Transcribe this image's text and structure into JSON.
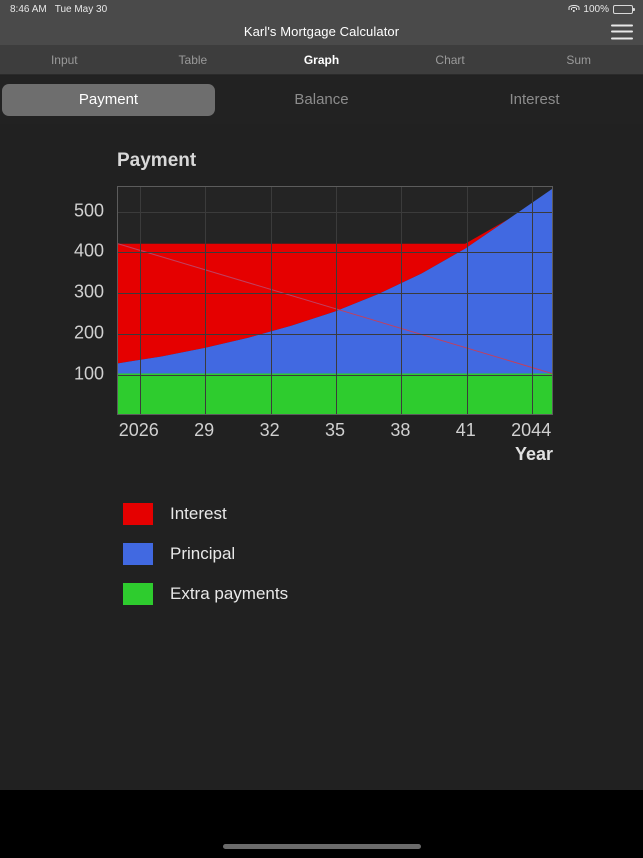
{
  "status_bar": {
    "time": "8:46 AM",
    "date": "Tue May 30",
    "battery_percent": "100%",
    "wifi_icon": "wifi-icon",
    "battery_icon": "battery-icon"
  },
  "nav": {
    "title": "Karl's Mortgage Calculator",
    "menu_icon": "hamburger-menu-icon"
  },
  "tabs": [
    {
      "label": "Input",
      "active": false
    },
    {
      "label": "Table",
      "active": false
    },
    {
      "label": "Graph",
      "active": true
    },
    {
      "label": "Chart",
      "active": false
    },
    {
      "label": "Sum",
      "active": false
    }
  ],
  "segments": [
    {
      "label": "Payment",
      "active": true
    },
    {
      "label": "Balance",
      "active": false
    },
    {
      "label": "Interest",
      "active": false
    }
  ],
  "colors": {
    "interest": "#e50000",
    "principal": "#4169e1",
    "extra": "#2ecc2e",
    "plot_bg": "#242424",
    "page_bg": "#212121",
    "navbar_bg": "#4a4a4a",
    "tabbar_bg": "#3d3d3d",
    "segment_active_bg": "#6e6e6e"
  },
  "legend": [
    {
      "label": "Interest",
      "color": "#e50000",
      "swatch": "legend-swatch-interest"
    },
    {
      "label": "Principal",
      "color": "#4169e1",
      "swatch": "legend-swatch-principal"
    },
    {
      "label": "Extra payments",
      "color": "#2ecc2e",
      "swatch": "legend-swatch-extra"
    }
  ],
  "chart_data": {
    "type": "area",
    "title": "Payment",
    "xlabel": "Year",
    "ylabel": "",
    "grid": true,
    "legend_position": "below",
    "stacked": true,
    "xlim": [
      2025,
      2045
    ],
    "ylim": [
      0,
      560
    ],
    "ytick_labels": [
      "100",
      "200",
      "300",
      "400",
      "500"
    ],
    "ytick_values": [
      100,
      200,
      300,
      400,
      500
    ],
    "xtick_labels": [
      "2026",
      "29",
      "32",
      "35",
      "38",
      "41",
      "2044"
    ],
    "xtick_values": [
      2026,
      2029,
      2032,
      2035,
      2038,
      2041,
      2044
    ],
    "x": [
      2025,
      2027,
      2029,
      2031,
      2033,
      2035,
      2037,
      2039,
      2041,
      2043,
      2045
    ],
    "series": [
      {
        "name": "Extra payments",
        "color": "#2ecc2e",
        "values": [
          100,
          100,
          100,
          100,
          100,
          100,
          100,
          100,
          100,
          100,
          100
        ]
      },
      {
        "name": "Principal",
        "color": "#4169e1",
        "values": [
          25,
          42,
          63,
          88,
          118,
          153,
          196,
          247,
          308,
          381,
          455
        ]
      },
      {
        "name": "Interest",
        "color": "#e50000",
        "values": [
          295,
          278,
          257,
          232,
          202,
          167,
          124,
          73,
          12,
          0,
          0
        ]
      }
    ],
    "annotations": [
      {
        "name": "interest-trend-line",
        "color": "#c04060",
        "from": [
          2025,
          420
        ],
        "to": [
          2045,
          100
        ]
      }
    ]
  },
  "bottom": {
    "home_indicator": "home-indicator"
  }
}
